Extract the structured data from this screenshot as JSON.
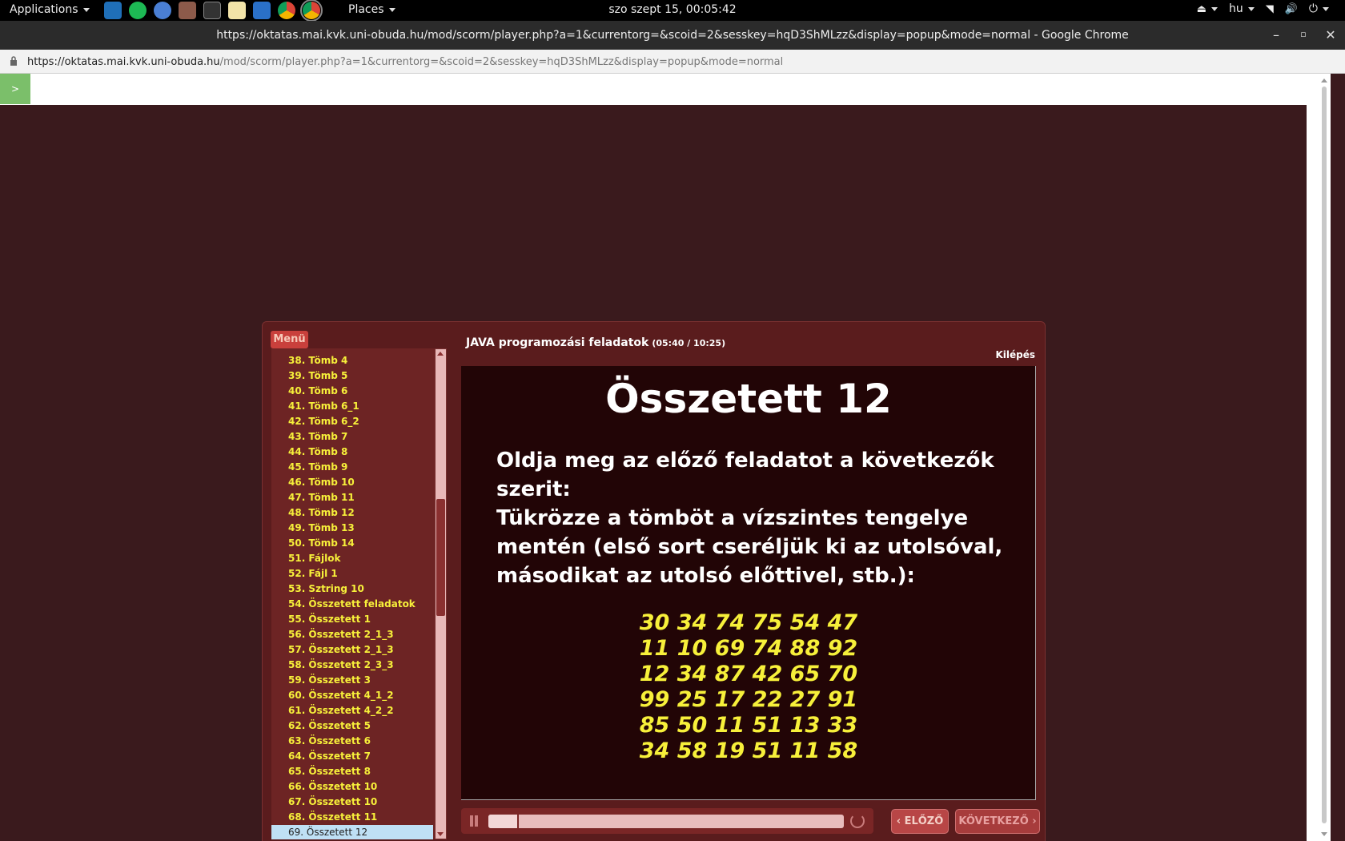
{
  "os_panel": {
    "applications_label": "Applications",
    "places_label": "Places",
    "clock": "szo szept 15, 00:05:42",
    "language": "hu"
  },
  "browser": {
    "window_title": "https://oktatas.mai.kvk.uni-obuda.hu/mod/scorm/player.php?a=1&currentorg=&scoid=2&sesskey=hqD3ShMLzz&display=popup&mode=normal - Google Chrome",
    "url_host": "https://oktatas.mai.kvk.uni-obuda.hu",
    "url_path": "/mod/scorm/player.php?a=1&currentorg=&scoid=2&sesskey=hqD3ShMLzz&display=popup&mode=normal",
    "toc_toggle": ">"
  },
  "player": {
    "menu_tab": "Menü",
    "course_title": "JAVA programozási feladatok",
    "course_time": "(05:40 / 10:25)",
    "exit_label": "Kilépés",
    "prev_label": "ELŐZŐ",
    "next_label": "KÖVETKEZŐ",
    "progress_fraction": 0.08,
    "menu_items": [
      "38. Tömb 4",
      "39. Tömb 5",
      "40. Tömb 6",
      "41. Tömb 6_1",
      "42. Tömb 6_2",
      "43. Tömb 7",
      "44. Tömb 8",
      "45. Tömb 9",
      "46. Tömb 10",
      "47. Tömb 11",
      "48. Tömb 12",
      "49. Tömb 13",
      "50. Tömb 14",
      "51. Fájlok",
      "52. Fájl 1",
      "53. Sztring 10",
      "54. Összetett  feladatok",
      "55. Összetett 1",
      "56. Összetett 2_1_3",
      "57. Összetett 2_1_3",
      "58. Összetett 2_3_3",
      "59. Összetett 3",
      "60. Összetett 4_1_2",
      "61. Összetett 4_2_2",
      "62. Összetett 5",
      "63. Összetett 6",
      "64. Összetett 7",
      "65. Összetett 8",
      "66. Összetett 10",
      "67. Összetett 10",
      "68. Összetett 11",
      "69. Összetett 12"
    ],
    "selected_index": 31
  },
  "slide": {
    "title": "Összetett 12",
    "text_lines": [
      "Oldja meg az előző feladatot a következők",
      "szerit:",
      "Tükrözze a tömböt a vízszintes tengelye",
      "mentén (első sort cseréljük ki az utolsóval,",
      "másodikat az utolsó előttivel, stb.):"
    ],
    "matrix_rows": [
      "30 34 74 75 54 47",
      "11 10 69 74 88 92",
      "12 34 87 42 65 70",
      "99 25 17 22 27 91",
      "85 50 11 51 13 33",
      "34 58 19 51 11 58"
    ]
  }
}
